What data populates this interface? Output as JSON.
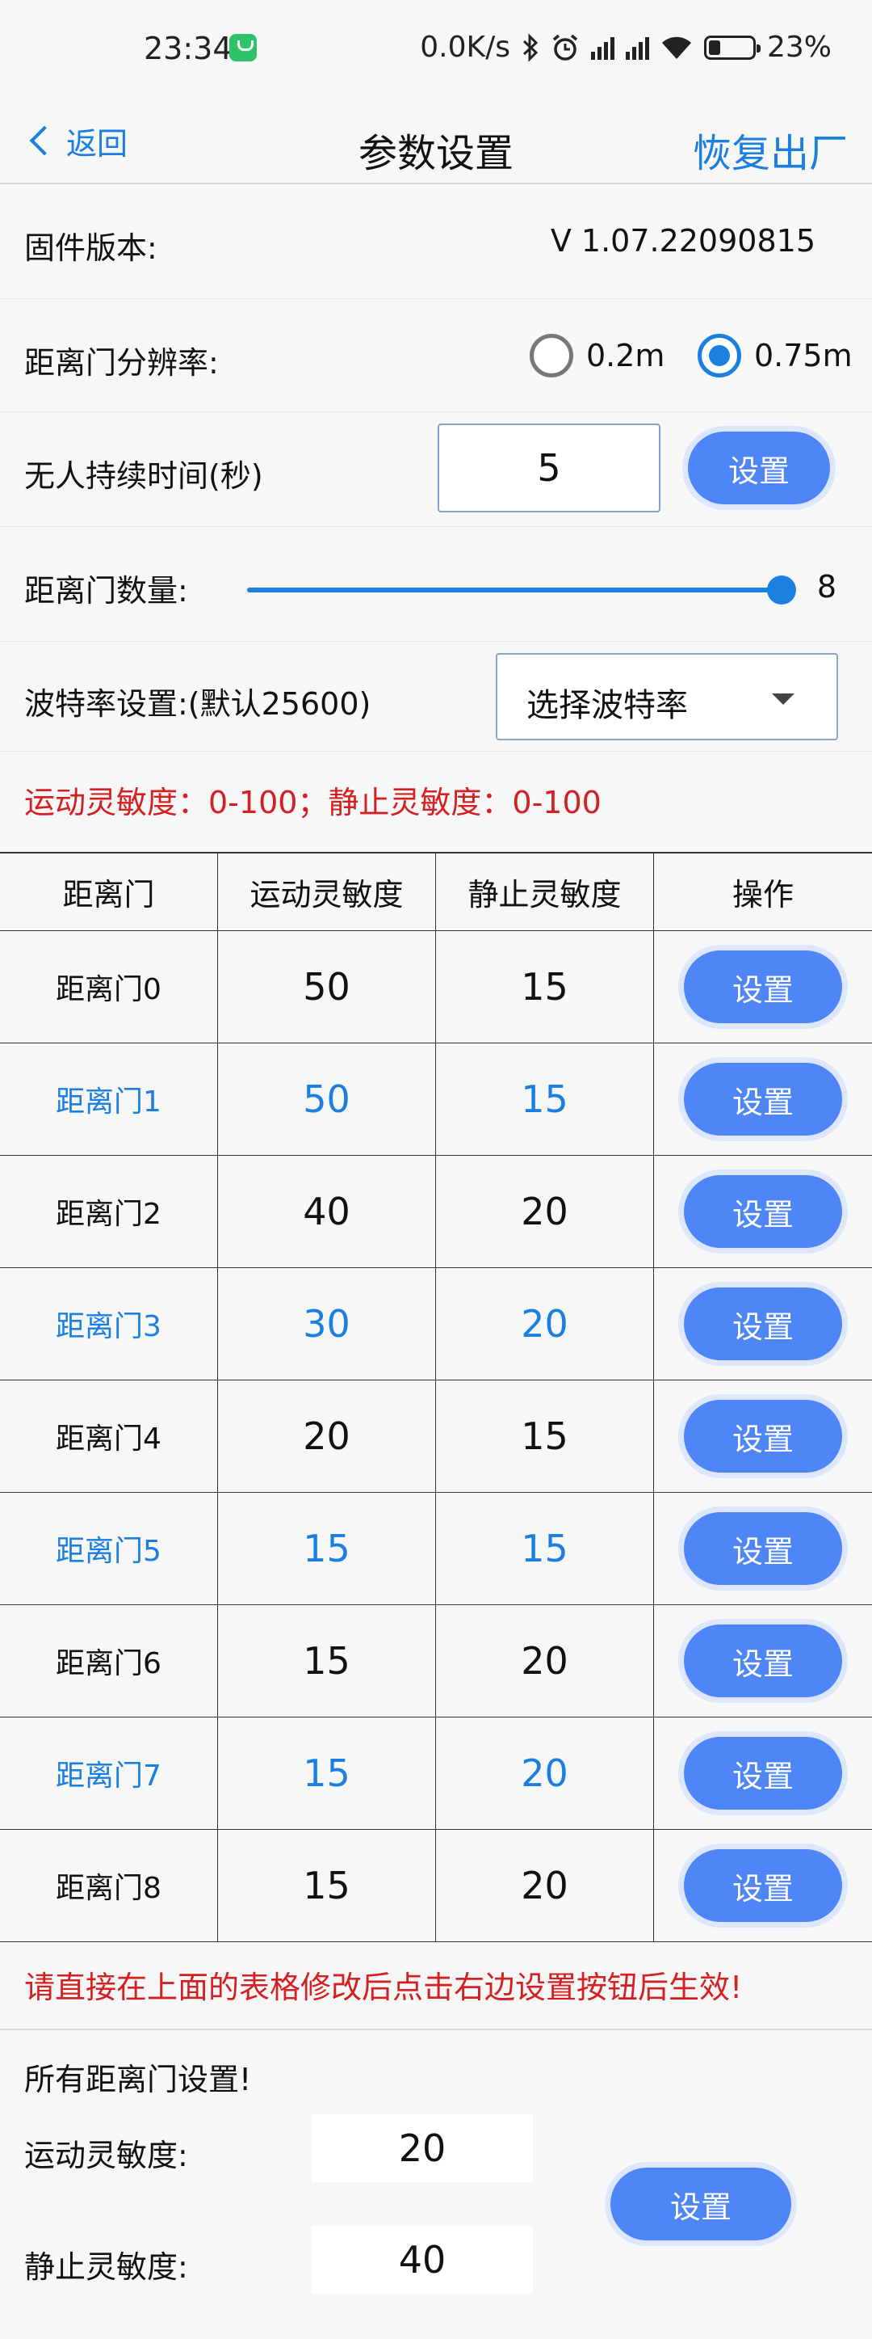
{
  "status_bar": {
    "time": "23:34",
    "net_speed": "0.0K/s",
    "battery": "23%",
    "icons": [
      "bluetooth-icon",
      "alarm-icon",
      "hd-signal-icon",
      "hd-signal-icon",
      "wifi-icon",
      "battery-icon"
    ]
  },
  "nav": {
    "back_label": "返回",
    "title": "参数设置",
    "reset_label": "恢复出厂"
  },
  "firmware": {
    "label": "固件版本:",
    "value": "V 1.07.22090815"
  },
  "resolution": {
    "label": "距离门分辨率:",
    "options": [
      "0.2m",
      "0.75m"
    ],
    "selected": "0.75m"
  },
  "no_person": {
    "label": "无人持续时间(秒)",
    "value": "5",
    "button": "设置"
  },
  "gate_count": {
    "label": "距离门数量:",
    "value": "8",
    "max": 8,
    "fraction": 1.0
  },
  "baud": {
    "label": "波特率设置:(默认25600)",
    "placeholder": "选择波特率"
  },
  "range_note": "运动灵敏度：0-100；静止灵敏度：0-100",
  "table": {
    "headers": [
      "距离门",
      "运动灵敏度",
      "静止灵敏度",
      "操作"
    ],
    "rows": [
      {
        "name": "距离门0",
        "motion": "50",
        "static": "15",
        "button": "设置"
      },
      {
        "name": "距离门1",
        "motion": "50",
        "static": "15",
        "button": "设置"
      },
      {
        "name": "距离门2",
        "motion": "40",
        "static": "20",
        "button": "设置"
      },
      {
        "name": "距离门3",
        "motion": "30",
        "static": "20",
        "button": "设置"
      },
      {
        "name": "距离门4",
        "motion": "20",
        "static": "15",
        "button": "设置"
      },
      {
        "name": "距离门5",
        "motion": "15",
        "static": "15",
        "button": "设置"
      },
      {
        "name": "距离门6",
        "motion": "15",
        "static": "20",
        "button": "设置"
      },
      {
        "name": "距离门7",
        "motion": "15",
        "static": "20",
        "button": "设置"
      },
      {
        "name": "距离门8",
        "motion": "15",
        "static": "20",
        "button": "设置"
      }
    ]
  },
  "table_note": "请直接在上面的表格修改后点击右边设置按钮后生效!",
  "all_gates": {
    "title": "所有距离门设置!",
    "motion_label": "运动灵敏度:",
    "motion_value": "20",
    "static_label": "静止灵敏度:",
    "static_value": "40",
    "button": "设置"
  },
  "colors": {
    "accent": "#1a7fe0",
    "button": "#4f86f7",
    "warning": "#d42020"
  }
}
